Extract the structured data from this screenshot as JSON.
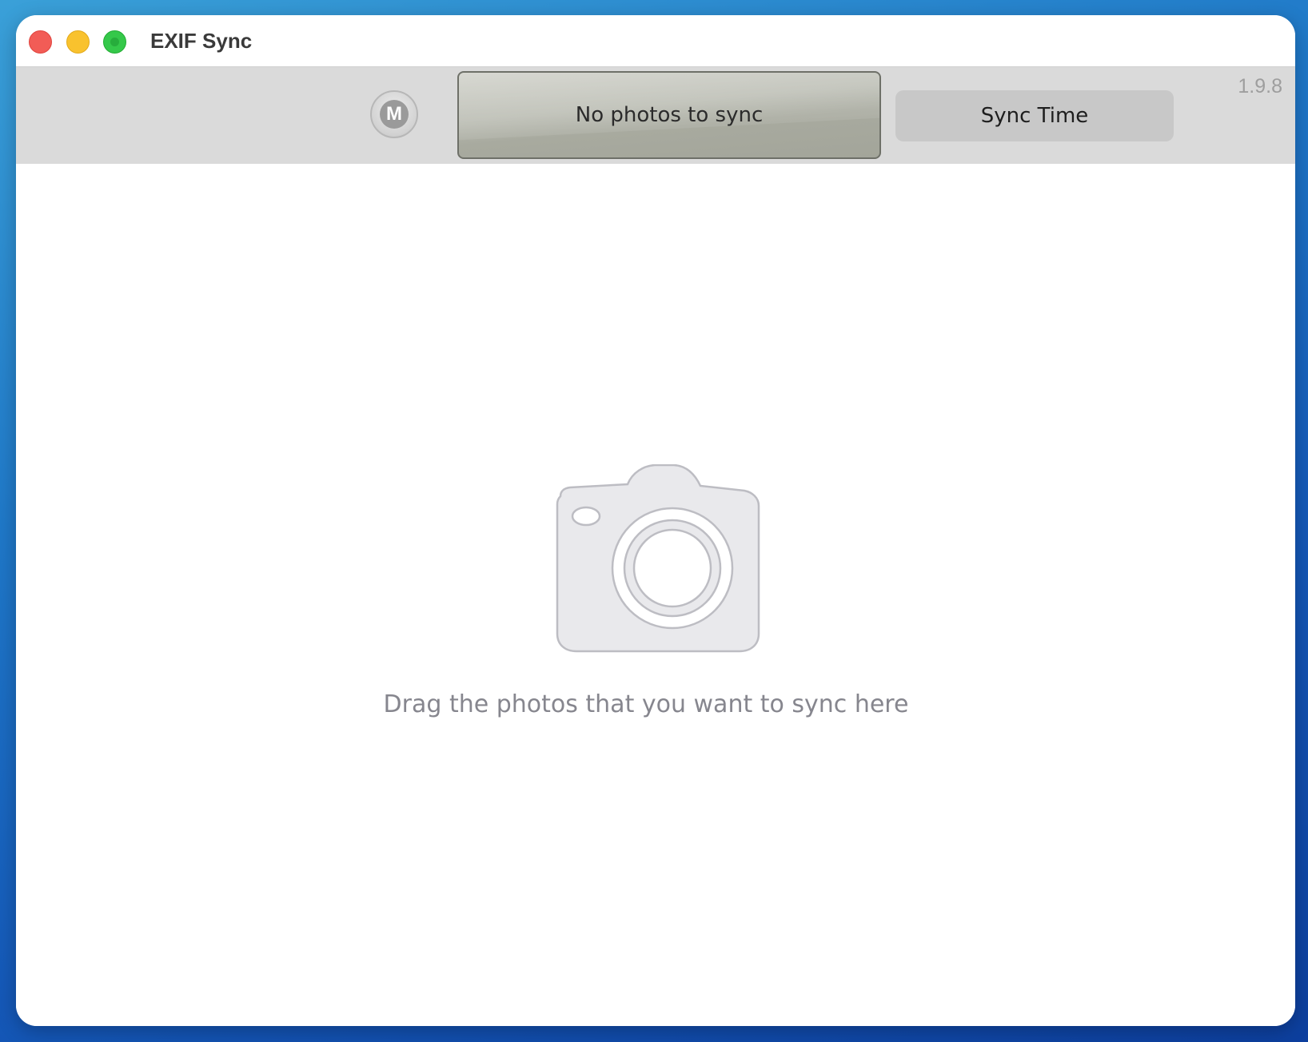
{
  "window": {
    "title": "EXIF Sync"
  },
  "toolbar": {
    "mode_button_label": "M",
    "status_text": "No photos to sync",
    "sync_button_label": "Sync Time",
    "version": "1.9.8"
  },
  "content": {
    "drop_hint": "Drag the photos that you want to sync here",
    "drop_icon": "camera-icon"
  },
  "colors": {
    "close": "#f25c56",
    "minimize": "#f9c22e",
    "maximize": "#35c84a",
    "toolbar_bg": "#dadada",
    "hint_text": "#86868e"
  }
}
